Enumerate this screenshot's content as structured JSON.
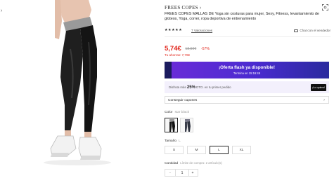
{
  "nav": {
    "prev_icon": "chevron-left-icon",
    "prev_glyph": "›"
  },
  "store": {
    "name": "FREES COPES",
    "chevron": "›"
  },
  "product": {
    "title": "FREES COPES MALLAS DE Yoga sin costuras para mujer, Sexy, Fitness, levantamiento de glúteos, Yoga, correr, ropa deportiva de entrenamiento",
    "stars": "★★★★★",
    "reviews": "7 Valoraciones",
    "seller_link": "Chat con el vendedor"
  },
  "price": {
    "current": "5,74€",
    "original": "13,50€",
    "discount": "-57%",
    "savings": "Tu ahorras: 7,76€"
  },
  "flash": {
    "title": "¡Oferta flash ya disponible!",
    "timer": "Termina en 15:16:45"
  },
  "promo": {
    "prefix": "Disfruta más",
    "percent": "25%",
    "suffix": "DTO. en tu primer pedido",
    "button": "¡Lo quiero!"
  },
  "coupon": {
    "label": "Conseguir cupones",
    "chevron": "›"
  },
  "color": {
    "label": "Color",
    "selected": "star black",
    "swatches": [
      "star black",
      "dark grey"
    ]
  },
  "size": {
    "label": "Tamaño",
    "selected": "L",
    "options": [
      "S",
      "M",
      "L",
      "XL"
    ]
  },
  "quantity": {
    "label": "Cantidad",
    "limit": "Límite de compra: 2 artículo(s)",
    "minus": "−",
    "value": "1",
    "plus": "+"
  },
  "colors": {
    "accent_red": "#e1251b",
    "flash_gradient_start": "#6b2bd8",
    "flash_gradient_end": "#2a2a9e",
    "promo_bg": "#f3f0fc"
  }
}
